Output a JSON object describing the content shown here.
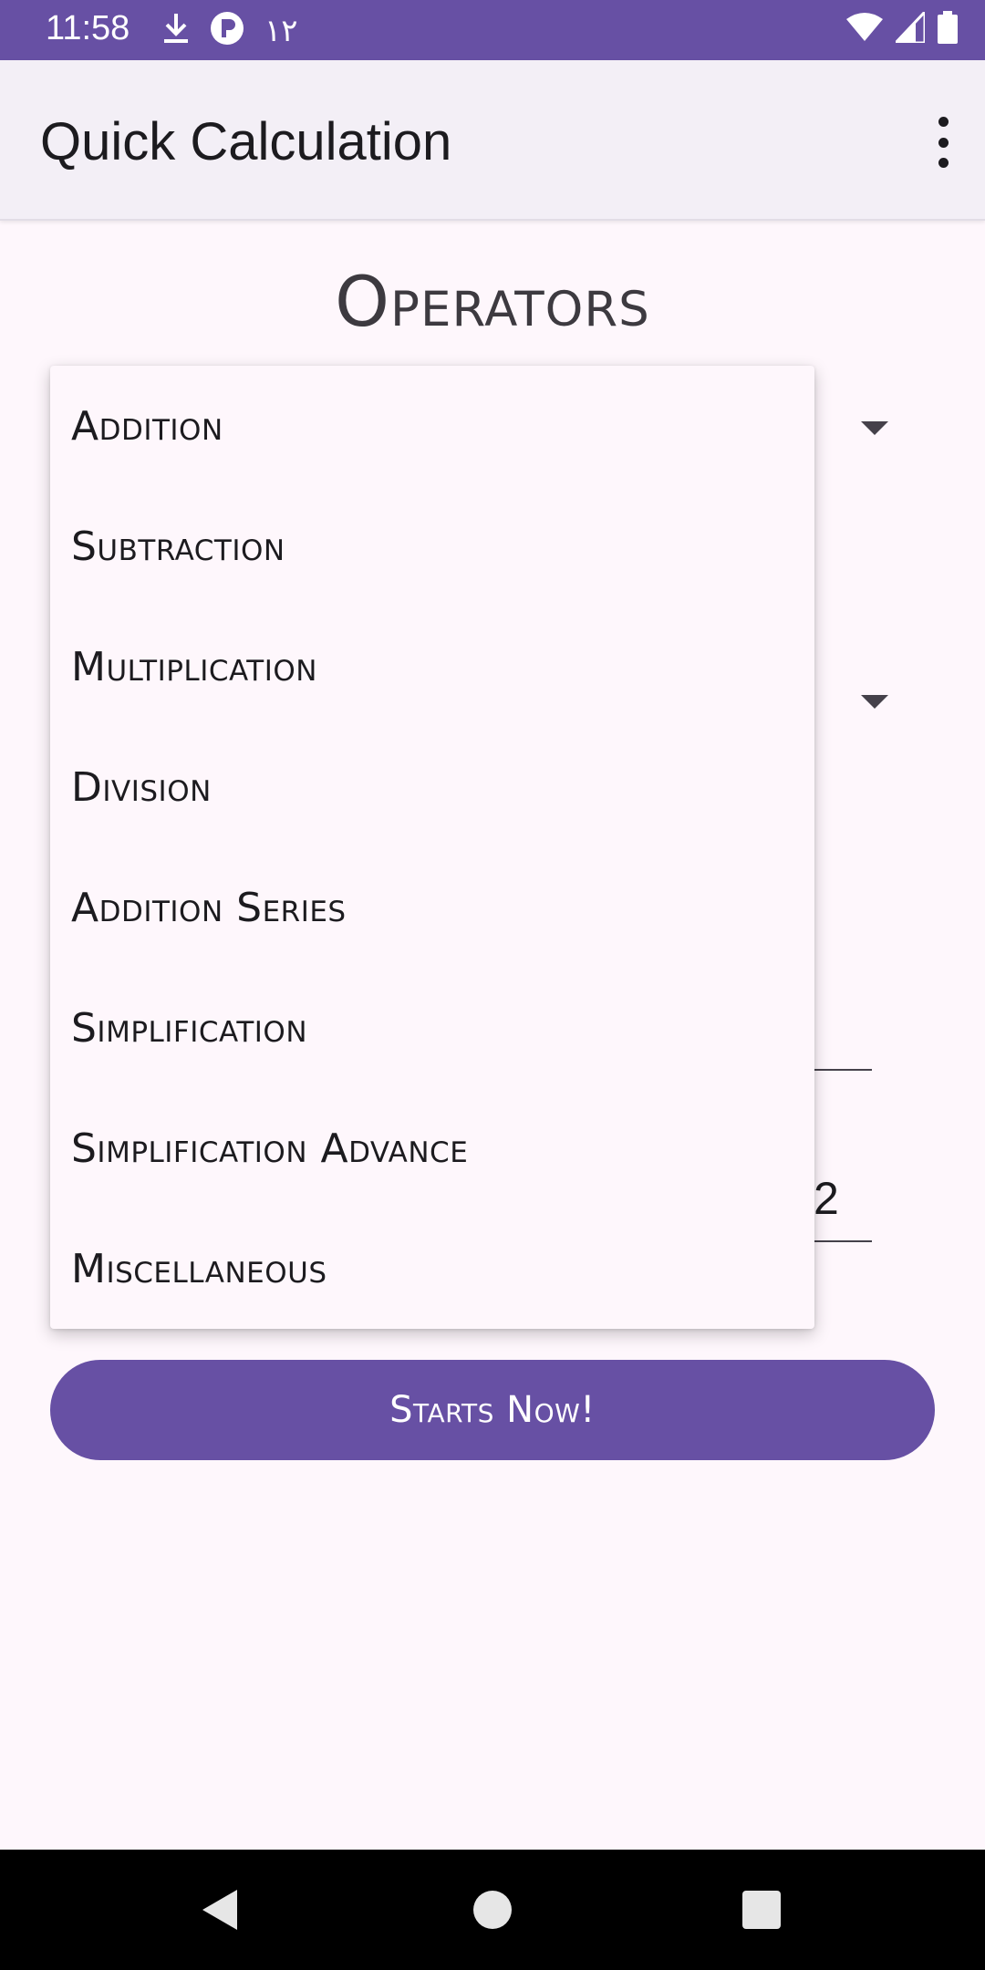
{
  "status_bar": {
    "time": "11:58",
    "arabic_text": "١٢",
    "icons_left": [
      "download-icon",
      "record-icon"
    ],
    "icons_right": [
      "wifi-icon",
      "signal-icon",
      "battery-icon"
    ]
  },
  "app_bar": {
    "title": "Quick Calculation",
    "menu_icon": "more-vert-icon"
  },
  "heading": "Operators",
  "dropdown": {
    "items": [
      "Addition",
      "Subtraction",
      "Multiplication",
      "Division",
      "Addition Series",
      "Simplification",
      "Simplification Advance",
      "Miscellaneous"
    ]
  },
  "background": {
    "field_value": "2"
  },
  "start_button": {
    "label": "Starts Now!"
  },
  "colors": {
    "primary": "#6750A4",
    "background": "#FEF7FC",
    "app_bar": "#F3EFF6"
  }
}
